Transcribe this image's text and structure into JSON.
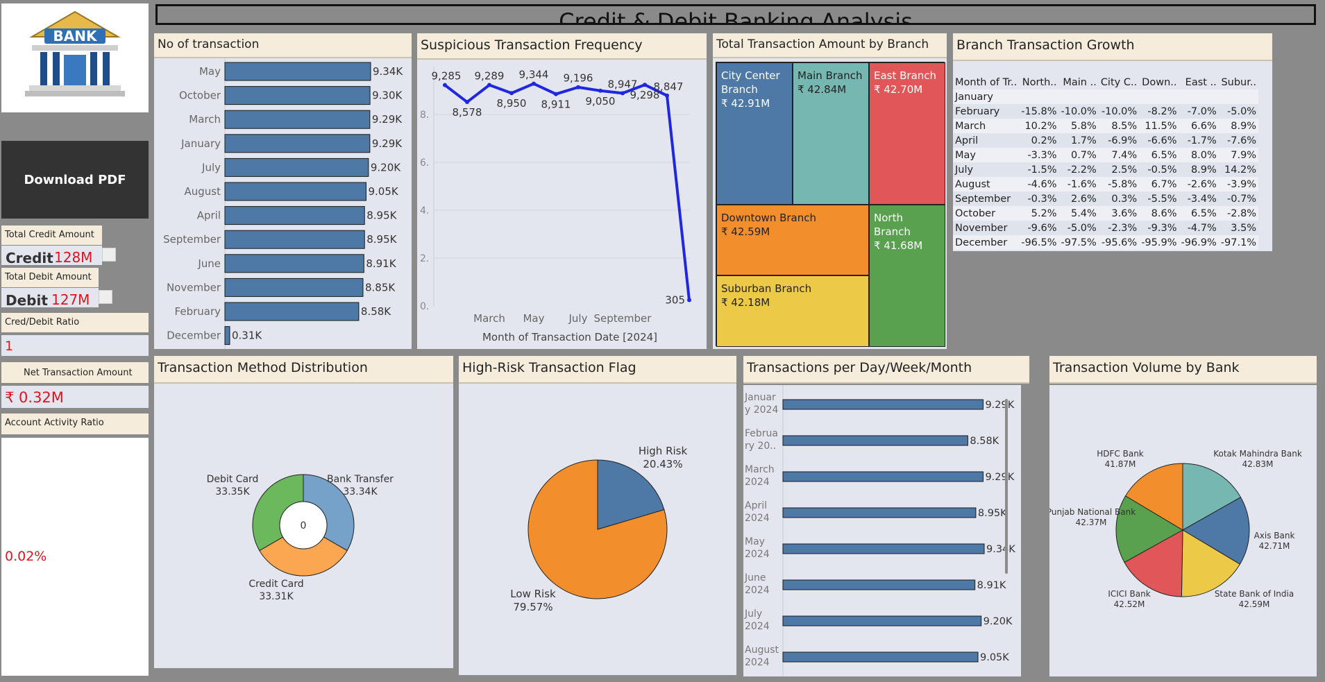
{
  "dashboard_title": "Credit & Debit Banking Analysis",
  "logo_text": "BANK",
  "sidebar": {
    "download_button": "Download PDF",
    "total_credit_label": "Total Credit Amount",
    "credit_word": "Credit",
    "credit_value": "128M",
    "total_debit_label": "Total Debit Amount",
    "debit_word": "Debit",
    "debit_value": "127M",
    "ratio_label": "Cred/Debit Ratio",
    "ratio_value": "1",
    "net_label": "Net Transaction Amount",
    "net_value": "₹ 0.32M",
    "activity_label": "Account Activity Ratio",
    "activity_value": "0.02%"
  },
  "panels": {
    "no_of_transaction": "No of transaction",
    "suspicious": "Suspicious Transaction Frequency",
    "branch_amount": "Total Transaction Amount by Branch",
    "branch_growth": "Branch Transaction Growth",
    "method": "Transaction Method Distribution",
    "high_risk": "High-Risk Transaction Flag",
    "per_day": "Transactions per Day/Week/Month",
    "volume_bank": "Transaction Volume by Bank"
  },
  "chart_data": [
    {
      "id": "no_of_transaction",
      "type": "bar",
      "orientation": "horizontal",
      "categories": [
        "May",
        "October",
        "March",
        "January",
        "July",
        "August",
        "April",
        "September",
        "June",
        "November",
        "February",
        "December"
      ],
      "values": [
        9340,
        9300,
        9290,
        9290,
        9200,
        9050,
        8950,
        8950,
        8910,
        8850,
        8580,
        310
      ],
      "labels": [
        "9.34K",
        "9.30K",
        "9.29K",
        "9.29K",
        "9.20K",
        "9.05K",
        "8.95K",
        "8.95K",
        "8.91K",
        "8.85K",
        "8.58K",
        "0.31K"
      ],
      "color": "#4e79a7"
    },
    {
      "id": "suspicious",
      "type": "line",
      "x": [
        "January",
        "February",
        "March",
        "April",
        "May",
        "June",
        "July",
        "August",
        "September",
        "October",
        "November",
        "December"
      ],
      "values": [
        9285,
        8578,
        9289,
        8950,
        9344,
        8911,
        9196,
        9050,
        8947,
        9298,
        8847,
        305
      ],
      "labels": [
        "9,285",
        "8,578",
        "9,289",
        "8,950",
        "9,344",
        "8,911",
        "9,196",
        "9,050",
        "8,947",
        "9,298",
        "8,847",
        "305"
      ],
      "xtick_labels": [
        "March",
        "May",
        "July",
        "September"
      ],
      "ytick_labels": [
        "0.",
        "2.",
        "4.",
        "6.",
        "8."
      ],
      "xlabel": "Month of Transaction Date [2024]",
      "color": "#2027e0"
    },
    {
      "id": "branch_amount",
      "type": "treemap",
      "items": [
        {
          "name": "City Center Branch",
          "value": "₹ 42.91M",
          "color": "#4e79a7"
        },
        {
          "name": "Main Branch",
          "value": "₹ 42.84M",
          "color": "#76b7b2"
        },
        {
          "name": "East Branch",
          "value": "₹ 42.70M",
          "color": "#e15759"
        },
        {
          "name": "Downtown Branch",
          "value": "₹ 42.59M",
          "color": "#f28e2b"
        },
        {
          "name": "North Branch",
          "value": "₹ 41.68M",
          "color": "#59a14f"
        },
        {
          "name": "Suburban Branch",
          "value": "₹ 42.18M",
          "color": "#edc948"
        }
      ]
    },
    {
      "id": "branch_growth",
      "type": "table",
      "columns": [
        "Month of Tr..",
        "North..",
        "Main ..",
        "City C..",
        "Down..",
        "East ..",
        "Subur.."
      ],
      "rows": [
        [
          "January",
          "",
          "",
          "",
          "",
          "",
          ""
        ],
        [
          "February",
          "-15.8%",
          "-10.0%",
          "-10.0%",
          "-8.2%",
          "-7.0%",
          "-5.0%"
        ],
        [
          "March",
          "10.2%",
          "5.8%",
          "8.5%",
          "11.5%",
          "6.6%",
          "8.9%"
        ],
        [
          "April",
          "0.2%",
          "1.7%",
          "-6.9%",
          "-6.6%",
          "-1.7%",
          "-7.6%"
        ],
        [
          "May",
          "-3.3%",
          "0.7%",
          "7.4%",
          "6.5%",
          "8.0%",
          "7.9%"
        ],
        [
          "July",
          "-1.5%",
          "-2.2%",
          "2.5%",
          "-0.5%",
          "8.9%",
          "14.2%"
        ],
        [
          "August",
          "-4.6%",
          "-1.6%",
          "-5.8%",
          "6.7%",
          "-2.6%",
          "-3.9%"
        ],
        [
          "September",
          "-0.3%",
          "2.6%",
          "0.3%",
          "-5.5%",
          "-3.4%",
          "-0.7%"
        ],
        [
          "October",
          "5.2%",
          "5.4%",
          "3.6%",
          "8.6%",
          "6.5%",
          "-2.8%"
        ],
        [
          "November",
          "-9.6%",
          "-5.0%",
          "-2.3%",
          "-9.3%",
          "-4.7%",
          "3.5%"
        ],
        [
          "December",
          "-96.5%",
          "-97.5%",
          "-95.6%",
          "-95.9%",
          "-96.9%",
          "-97.1%"
        ]
      ]
    },
    {
      "id": "method",
      "type": "pie",
      "donut": true,
      "center_label": "0",
      "slices": [
        {
          "name": "Bank Transfer",
          "value": 33340,
          "label": "33.34K",
          "color": "#76a1c9"
        },
        {
          "name": "Credit Card",
          "value": 33310,
          "label": "33.31K",
          "color": "#fba650"
        },
        {
          "name": "Debit Card",
          "value": 33350,
          "label": "33.35K",
          "color": "#6cb85c"
        }
      ]
    },
    {
      "id": "high_risk",
      "type": "pie",
      "slices": [
        {
          "name": "High Risk",
          "value": 20.43,
          "label": "20.43%",
          "color": "#4e79a7"
        },
        {
          "name": "Low Risk",
          "value": 79.57,
          "label": "79.57%",
          "color": "#f28e2b"
        }
      ]
    },
    {
      "id": "per_day",
      "type": "bar",
      "orientation": "horizontal",
      "categories": [
        [
          "Januar",
          "y 2024"
        ],
        [
          "Februa",
          "ry 20.."
        ],
        [
          "March",
          "2024"
        ],
        [
          "April",
          "2024"
        ],
        [
          "May",
          "2024"
        ],
        [
          "June",
          "2024"
        ],
        [
          "July",
          "2024"
        ],
        [
          "August",
          "2024"
        ]
      ],
      "values": [
        9290,
        8580,
        9290,
        8950,
        9340,
        8910,
        9200,
        9050
      ],
      "labels": [
        "9.29K",
        "8.58K",
        "9.29K",
        "8.95K",
        "9.34K",
        "8.91K",
        "9.20K",
        "9.05K"
      ],
      "color": "#4e79a7"
    },
    {
      "id": "volume_bank",
      "type": "pie",
      "slices": [
        {
          "name": "Kotak Mahindra Bank",
          "value": 42.83,
          "label": "42.83M",
          "color": "#76b7b2"
        },
        {
          "name": "Axis Bank",
          "value": 42.71,
          "label": "42.71M",
          "color": "#4e79a7"
        },
        {
          "name": "State Bank of India",
          "value": 42.59,
          "label": "42.59M",
          "color": "#edc948"
        },
        {
          "name": "ICICI Bank",
          "value": 42.52,
          "label": "42.52M",
          "color": "#e15759"
        },
        {
          "name": "Punjab National Bank",
          "value": 42.37,
          "label": "42.37M",
          "color": "#59a14f"
        },
        {
          "name": "HDFC Bank",
          "value": 41.87,
          "label": "41.87M",
          "color": "#f28e2b"
        }
      ]
    }
  ]
}
